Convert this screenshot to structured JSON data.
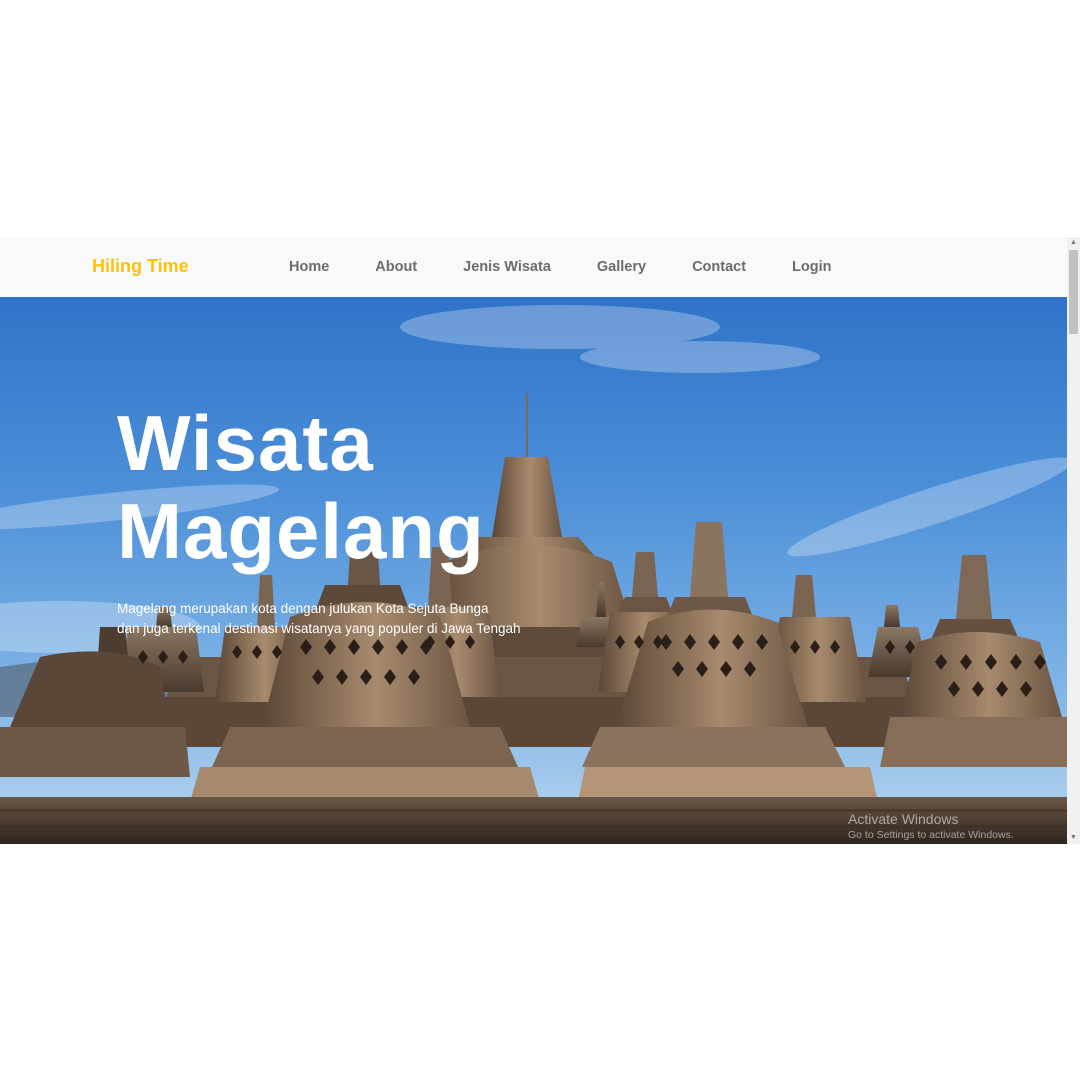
{
  "navbar": {
    "brand": "Hiling Time",
    "links": [
      "Home",
      "About",
      "Jenis Wisata",
      "Gallery",
      "Contact",
      "Login"
    ]
  },
  "hero": {
    "title_line1": "Wisata",
    "title_line2": "Magelang",
    "desc_line1": "Magelang merupakan kota dengan julukan Kota Sejuta Bunga",
    "desc_line2": "dan juga terkenal destinasi wisatanya yang populer di Jawa Tengah",
    "image": "borobudur-temple-stupas"
  },
  "watermark": {
    "line1": "Activate Windows",
    "line2": "Go to Settings to activate Windows."
  },
  "scrollbar": {
    "up_icon": "scroll-up-arrow-icon",
    "down_icon": "scroll-down-arrow-icon"
  },
  "colors": {
    "brand": "#ffc107",
    "navbar_bg": "#f8f9fa",
    "nav_link": "#6c6c6c"
  }
}
